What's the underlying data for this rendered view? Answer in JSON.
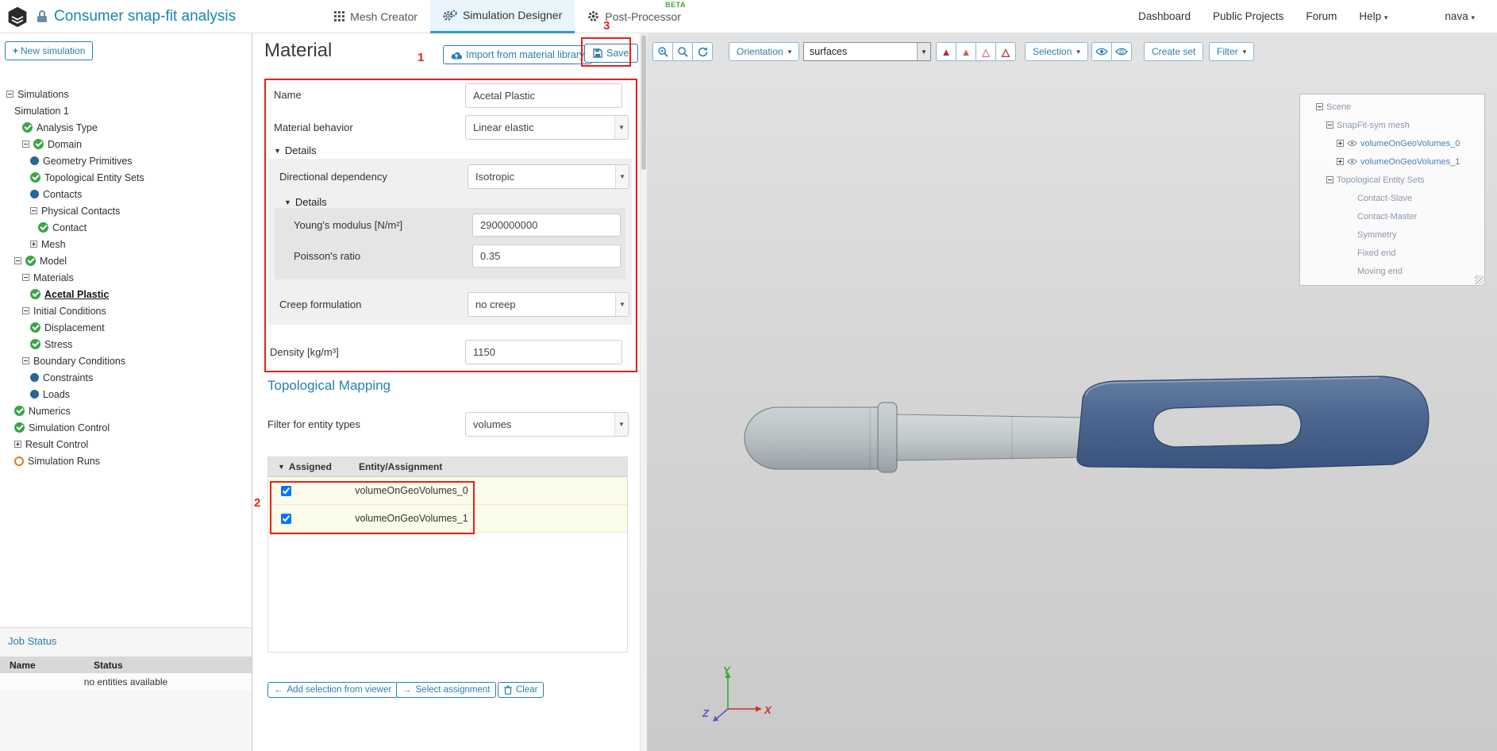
{
  "navbar": {
    "title": "Consumer snap-fit analysis",
    "tabs": [
      {
        "label": "Mesh Creator"
      },
      {
        "label": "Simulation Designer",
        "active": true
      },
      {
        "label": "Post-Processor",
        "badge": "BETA"
      }
    ],
    "links": [
      {
        "label": "Dashboard"
      },
      {
        "label": "Public Projects"
      },
      {
        "label": "Forum"
      }
    ],
    "help_label": "Help",
    "user_label": "nava"
  },
  "sidebar": {
    "new_simulation_label": "New simulation",
    "tree": [
      {
        "label": "Simulations",
        "level": 0,
        "expander": "minus",
        "icon": "none"
      },
      {
        "label": "Simulation 1",
        "level": 1,
        "expander": null,
        "icon": "none"
      },
      {
        "label": "Analysis Type",
        "level": 2,
        "expander": null,
        "icon": "check"
      },
      {
        "label": "Domain",
        "level": 2,
        "expander": "minus",
        "icon": "check"
      },
      {
        "label": "Geometry Primitives",
        "level": 3,
        "expander": null,
        "icon": "dot"
      },
      {
        "label": "Topological Entity Sets",
        "level": 3,
        "expander": null,
        "icon": "check"
      },
      {
        "label": "Contacts",
        "level": 3,
        "expander": null,
        "icon": "dot"
      },
      {
        "label": "Physical Contacts",
        "level": 3,
        "expander": "minus",
        "icon": "none"
      },
      {
        "label": "Contact",
        "level": 4,
        "expander": null,
        "icon": "check"
      },
      {
        "label": "Mesh",
        "level": 3,
        "expander": "plus",
        "icon": "none"
      },
      {
        "label": "Model",
        "level": 1,
        "expander": "minus",
        "icon": "check"
      },
      {
        "label": "Materials",
        "level": 2,
        "expander": "minus",
        "icon": "none"
      },
      {
        "label": "Acetal Plastic",
        "level": 3,
        "expander": null,
        "icon": "check",
        "selected": true
      },
      {
        "label": "Initial Conditions",
        "level": 2,
        "expander": "minus",
        "icon": "none"
      },
      {
        "label": "Displacement",
        "level": 3,
        "expander": null,
        "icon": "check"
      },
      {
        "label": "Stress",
        "level": 3,
        "expander": null,
        "icon": "check"
      },
      {
        "label": "Boundary Conditions",
        "level": 2,
        "expander": "minus",
        "icon": "none"
      },
      {
        "label": "Constraints",
        "level": 3,
        "expander": null,
        "icon": "dot"
      },
      {
        "label": "Loads",
        "level": 3,
        "expander": null,
        "icon": "dot"
      },
      {
        "label": "Numerics",
        "level": 1,
        "expander": null,
        "icon": "check"
      },
      {
        "label": "Simulation Control",
        "level": 1,
        "expander": null,
        "icon": "check"
      },
      {
        "label": "Result Control",
        "level": 1,
        "expander": "plus",
        "icon": "none"
      },
      {
        "label": "Simulation Runs",
        "level": 1,
        "expander": null,
        "icon": "pending"
      }
    ],
    "job_status": {
      "title": "Job Status",
      "columns": [
        "Name",
        "Status"
      ],
      "empty_message": "no entities available"
    }
  },
  "panel": {
    "title": "Material",
    "import_button_label": "Import from material library",
    "save_button_label": "Save",
    "name_label": "Name",
    "name_value": "Acetal Plastic",
    "behavior_label": "Material behavior",
    "behavior_value": "Linear elastic",
    "details_label": "Details",
    "directional_label": "Directional dependency",
    "directional_value": "Isotropic",
    "inner_details_label": "Details",
    "youngs_label": "Young's modulus [N/m²]",
    "youngs_value": "2900000000",
    "poisson_label": "Poisson's ratio",
    "poisson_value": "0.35",
    "creep_label": "Creep formulation",
    "creep_value": "no creep",
    "density_label": "Density [kg/m³]",
    "density_value": "1150",
    "mapping": {
      "title": "Topological Mapping",
      "filter_label": "Filter for entity types",
      "filter_value": "volumes",
      "columns": [
        "Assigned",
        "Entity/Assignment"
      ],
      "rows": [
        {
          "assigned": true,
          "entity": "volumeOnGeoVolumes_0"
        },
        {
          "assigned": true,
          "entity": "volumeOnGeoVolumes_1"
        }
      ],
      "buttons": {
        "add_selection": "Add selection from viewer",
        "select_assignment": "Select assignment",
        "clear": "Clear"
      }
    }
  },
  "viewer": {
    "toolbar": {
      "orientation_label": "Orientation",
      "surfaces_value": "surfaces",
      "selection_label": "Selection",
      "create_set_label": "Create set",
      "filter_label": "Filter",
      "icons": [
        "zoom-window-icon",
        "zoom-fit-icon",
        "refresh-icon",
        "triangle-solid-icon",
        "triangle-solid-light-icon",
        "triangle-outline-icon",
        "triangle-outline-bold-icon",
        "show-eye-icon",
        "hide-eye-icon"
      ]
    },
    "scene_tree": [
      {
        "label": "Scene",
        "level": 0,
        "expander": "minus",
        "eye": false,
        "link": false
      },
      {
        "label": "SnapFit-sym mesh",
        "level": 1,
        "expander": "minus",
        "eye": false,
        "link": false
      },
      {
        "label": "volumeOnGeoVolumes_0",
        "level": 2,
        "expander": "plus",
        "eye": true,
        "link": true
      },
      {
        "label": "volumeOnGeoVolumes_1",
        "level": 2,
        "expander": "plus",
        "eye": true,
        "link": true
      },
      {
        "label": "Topological Entity Sets",
        "level": 1,
        "expander": "minus",
        "eye": false,
        "link": false
      },
      {
        "label": "Contact-Slave",
        "level": 4,
        "expander": null,
        "eye": false,
        "link": false
      },
      {
        "label": "Contact-Master",
        "level": 4,
        "expander": null,
        "eye": false,
        "link": false
      },
      {
        "label": "Symmetry",
        "level": 4,
        "expander": null,
        "eye": false,
        "link": false
      },
      {
        "label": "Fixed end",
        "level": 4,
        "expander": null,
        "eye": false,
        "link": false
      },
      {
        "label": "Moving end",
        "level": 4,
        "expander": null,
        "eye": false,
        "link": false
      }
    ],
    "axes": {
      "x": "X",
      "y": "Y",
      "z": "Z"
    }
  },
  "annotations": {
    "one": "1",
    "two": "2",
    "three": "3"
  }
}
